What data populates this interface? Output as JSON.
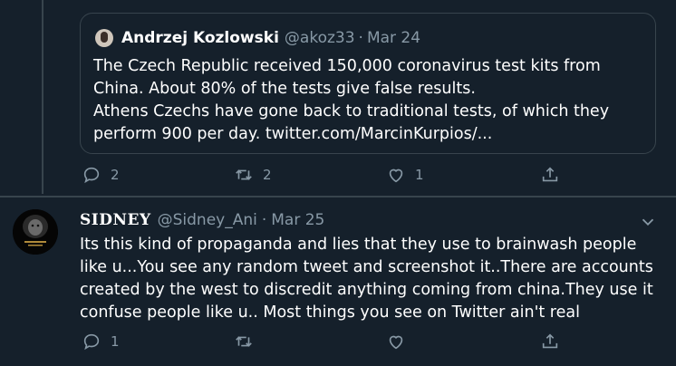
{
  "quoted_tweet": {
    "author_name": "Andrzej Kozlowski",
    "handle": "@akoz33",
    "separator": "·",
    "date": "Mar 24",
    "lines": [
      "The Czech Republic received 150,000 coronavirus test kits from",
      "China. About 80% of the tests give false results.",
      "Athens Czechs have gone back to traditional tests, of which they",
      "perform 900 per day. twitter.com/MarcinKurpios/..."
    ]
  },
  "parent_actions": {
    "reply_count": "2",
    "retweet_count": "2",
    "like_count": "1"
  },
  "reply_tweet": {
    "author_name": "SIDNEY",
    "handle": "@Sidney_Ani",
    "separator": "·",
    "date": "Mar 25",
    "lines": [
      "Its this kind of propaganda and lies that they use to brainwash people",
      "like u...You see any random tweet and screenshot it..There are accounts",
      "created by the west to discredit anything coming from china.They use it",
      "confuse people like u.. Most things you see on Twitter ain't real"
    ],
    "actions": {
      "reply_count": "1",
      "retweet_count": "",
      "like_count": ""
    }
  },
  "colors": {
    "background": "#15202b",
    "border": "#38444d",
    "muted": "#8899a6",
    "text": "#ffffff"
  },
  "icons": [
    "reply-icon",
    "retweet-icon",
    "like-icon",
    "share-icon",
    "chevron-down-icon"
  ]
}
